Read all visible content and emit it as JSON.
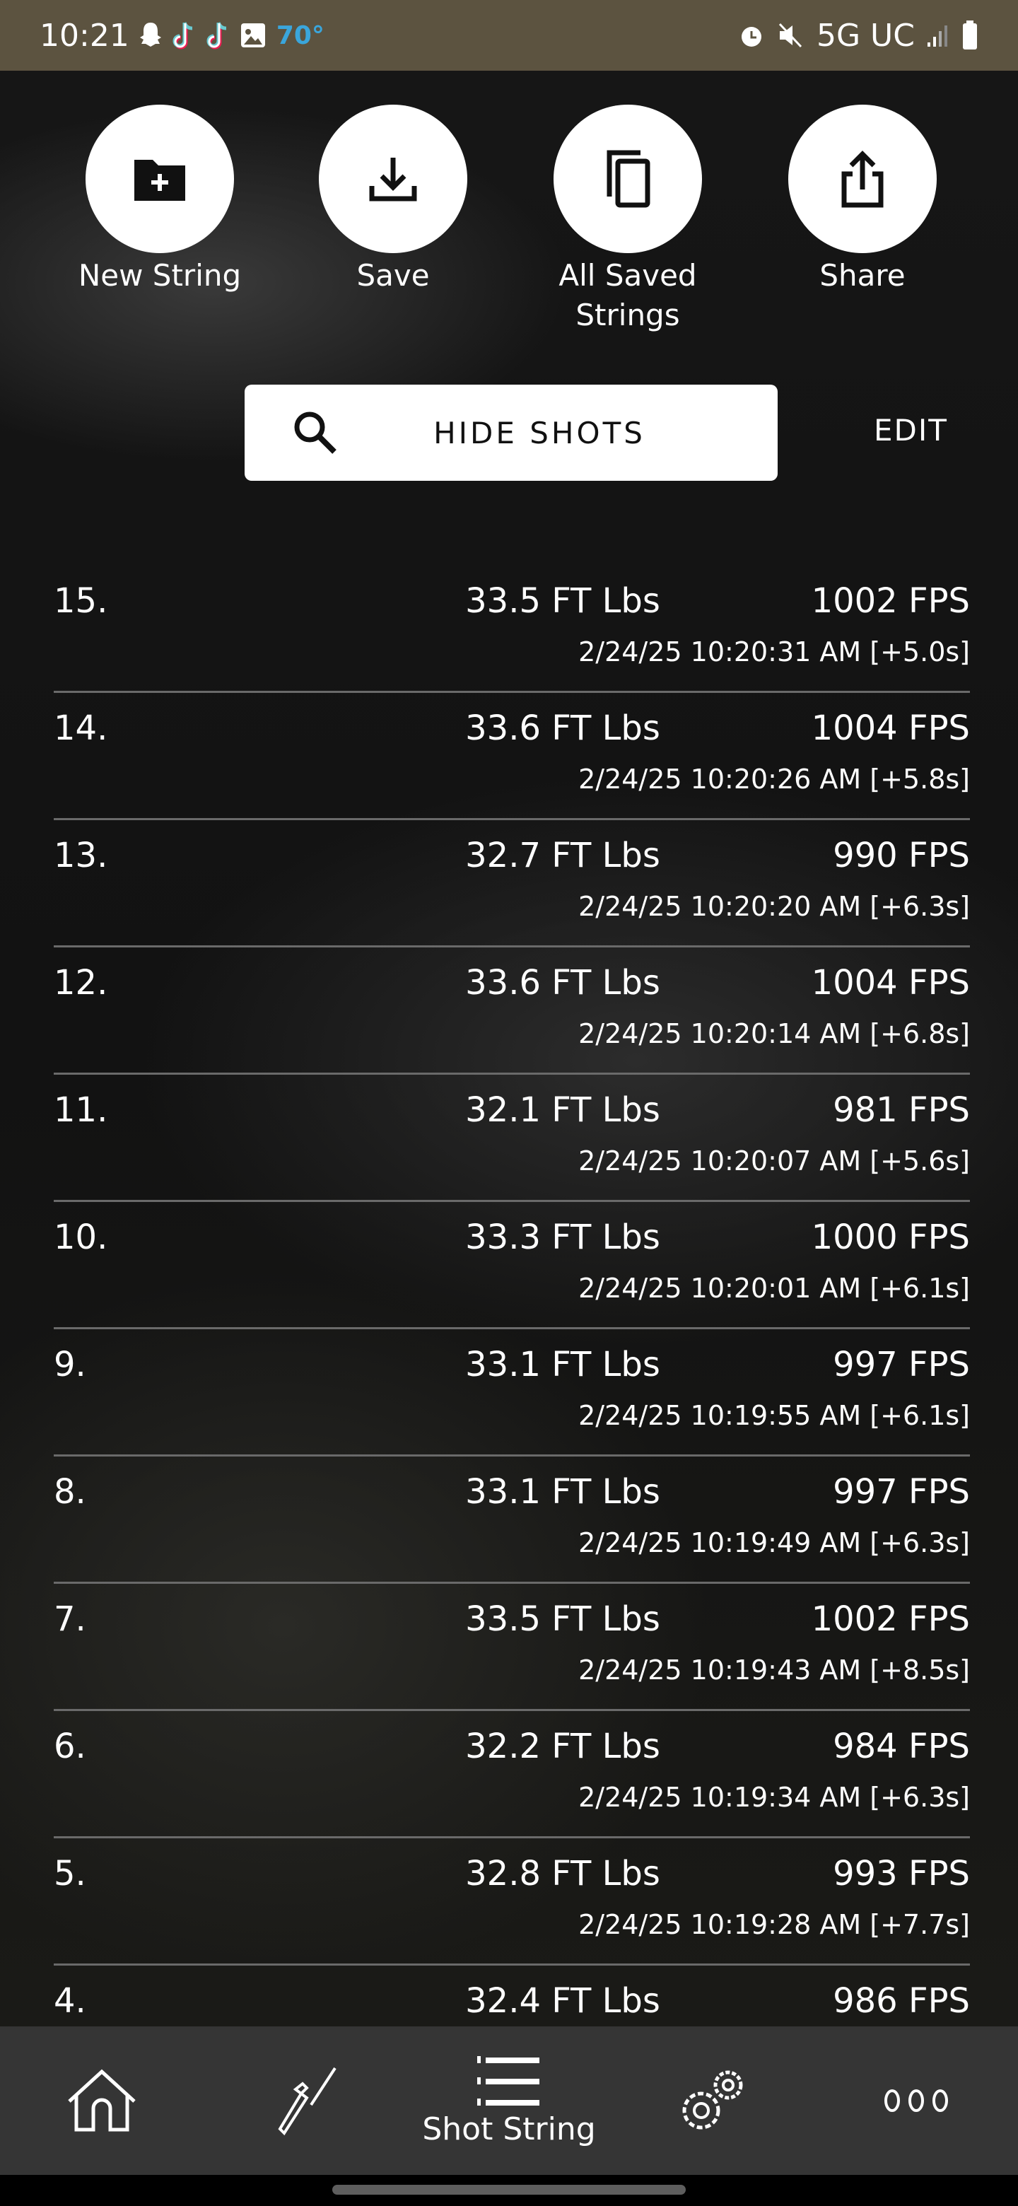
{
  "status_bar": {
    "time": "10:21",
    "temperature": "70°",
    "network": "5G UC",
    "icons": [
      "snapchat-icon",
      "tiktok-icon",
      "tiktok-icon",
      "gallery-icon",
      "alarm-icon",
      "mute-icon",
      "signal-icon",
      "battery-icon"
    ]
  },
  "actions": [
    {
      "label": "New String",
      "icon": "new-folder-icon"
    },
    {
      "label": "Save",
      "icon": "download-icon"
    },
    {
      "label": "All Saved Strings",
      "icon": "copy-icon"
    },
    {
      "label": "Share",
      "icon": "share-icon"
    }
  ],
  "search": {
    "label": "HIDE SHOTS",
    "icon": "search-icon"
  },
  "edit_label": "EDIT",
  "shots": [
    {
      "num": "15.",
      "energy": "33.5 FT Lbs",
      "velocity": "1002 FPS",
      "timestamp": "2/24/25 10:20:31 AM [+5.0s]"
    },
    {
      "num": "14.",
      "energy": "33.6 FT Lbs",
      "velocity": "1004 FPS",
      "timestamp": "2/24/25 10:20:26 AM [+5.8s]"
    },
    {
      "num": "13.",
      "energy": "32.7 FT Lbs",
      "velocity": "990 FPS",
      "timestamp": "2/24/25 10:20:20 AM [+6.3s]"
    },
    {
      "num": "12.",
      "energy": "33.6 FT Lbs",
      "velocity": "1004 FPS",
      "timestamp": "2/24/25 10:20:14 AM [+6.8s]"
    },
    {
      "num": "11.",
      "energy": "32.1 FT Lbs",
      "velocity": "981 FPS",
      "timestamp": "2/24/25 10:20:07 AM [+5.6s]"
    },
    {
      "num": "10.",
      "energy": "33.3 FT Lbs",
      "velocity": "1000 FPS",
      "timestamp": "2/24/25 10:20:01 AM [+6.1s]"
    },
    {
      "num": "9.",
      "energy": "33.1 FT Lbs",
      "velocity": "997 FPS",
      "timestamp": "2/24/25 10:19:55 AM [+6.1s]"
    },
    {
      "num": "8.",
      "energy": "33.1 FT Lbs",
      "velocity": "997 FPS",
      "timestamp": "2/24/25 10:19:49 AM [+6.3s]"
    },
    {
      "num": "7.",
      "energy": "33.5 FT Lbs",
      "velocity": "1002 FPS",
      "timestamp": "2/24/25 10:19:43 AM [+8.5s]"
    },
    {
      "num": "6.",
      "energy": "32.2 FT Lbs",
      "velocity": "984 FPS",
      "timestamp": "2/24/25 10:19:34 AM [+6.3s]"
    },
    {
      "num": "5.",
      "energy": "32.8 FT Lbs",
      "velocity": "993 FPS",
      "timestamp": "2/24/25 10:19:28 AM [+7.7s]"
    },
    {
      "num": "4.",
      "energy": "32.4 FT Lbs",
      "velocity": "986 FPS",
      "timestamp": ""
    }
  ],
  "nav": [
    {
      "icon": "home-icon",
      "label": ""
    },
    {
      "icon": "rifle-icon",
      "label": ""
    },
    {
      "icon": "list-icon",
      "label": "Shot String",
      "active": true
    },
    {
      "icon": "settings-icon",
      "label": ""
    },
    {
      "icon": "more-icon",
      "label": ""
    }
  ]
}
